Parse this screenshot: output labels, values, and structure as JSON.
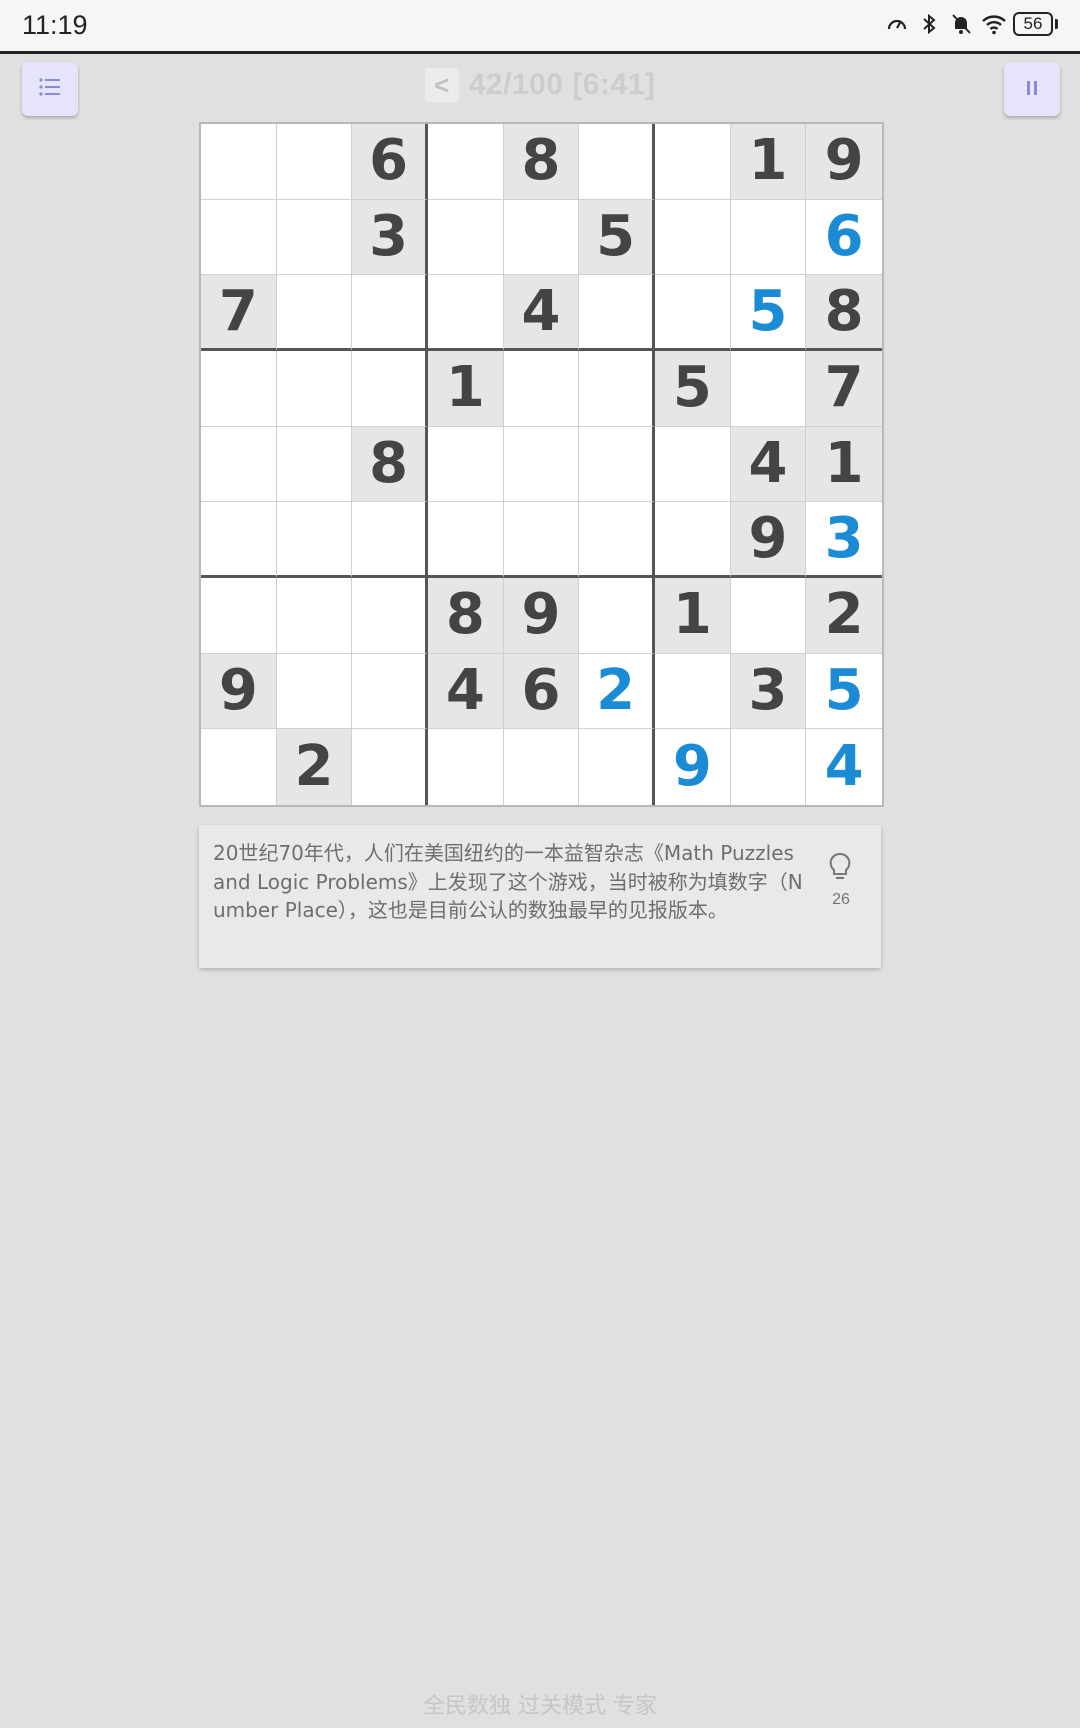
{
  "status_bar": {
    "time": "11:19",
    "battery": "56",
    "icons": [
      "speed-icon",
      "bluetooth-icon",
      "bell-off-icon",
      "wifi-icon"
    ]
  },
  "header": {
    "back_label": "<",
    "title": "42/100 [6:41]",
    "menu_icon": "menu-icon",
    "pause_icon": "pause-icon"
  },
  "board": {
    "rows": [
      [
        {
          "v": "",
          "t": "empty"
        },
        {
          "v": "",
          "t": "empty"
        },
        {
          "v": "6",
          "t": "given"
        },
        {
          "v": "",
          "t": "empty"
        },
        {
          "v": "8",
          "t": "given"
        },
        {
          "v": "",
          "t": "empty"
        },
        {
          "v": "",
          "t": "empty"
        },
        {
          "v": "1",
          "t": "given"
        },
        {
          "v": "9",
          "t": "given"
        }
      ],
      [
        {
          "v": "",
          "t": "empty"
        },
        {
          "v": "",
          "t": "empty"
        },
        {
          "v": "3",
          "t": "given"
        },
        {
          "v": "",
          "t": "empty"
        },
        {
          "v": "",
          "t": "empty"
        },
        {
          "v": "5",
          "t": "given"
        },
        {
          "v": "",
          "t": "empty"
        },
        {
          "v": "",
          "t": "empty"
        },
        {
          "v": "6",
          "t": "user"
        }
      ],
      [
        {
          "v": "7",
          "t": "given"
        },
        {
          "v": "",
          "t": "empty"
        },
        {
          "v": "",
          "t": "empty"
        },
        {
          "v": "",
          "t": "empty"
        },
        {
          "v": "4",
          "t": "given"
        },
        {
          "v": "",
          "t": "empty"
        },
        {
          "v": "",
          "t": "empty"
        },
        {
          "v": "5",
          "t": "user"
        },
        {
          "v": "8",
          "t": "given"
        }
      ],
      [
        {
          "v": "",
          "t": "empty"
        },
        {
          "v": "",
          "t": "empty"
        },
        {
          "v": "",
          "t": "empty"
        },
        {
          "v": "1",
          "t": "given"
        },
        {
          "v": "",
          "t": "empty"
        },
        {
          "v": "",
          "t": "empty"
        },
        {
          "v": "5",
          "t": "given"
        },
        {
          "v": "",
          "t": "empty"
        },
        {
          "v": "7",
          "t": "given"
        }
      ],
      [
        {
          "v": "",
          "t": "empty"
        },
        {
          "v": "",
          "t": "empty"
        },
        {
          "v": "8",
          "t": "given"
        },
        {
          "v": "",
          "t": "empty"
        },
        {
          "v": "",
          "t": "empty"
        },
        {
          "v": "",
          "t": "empty"
        },
        {
          "v": "",
          "t": "empty"
        },
        {
          "v": "4",
          "t": "given"
        },
        {
          "v": "1",
          "t": "given"
        }
      ],
      [
        {
          "v": "",
          "t": "empty"
        },
        {
          "v": "",
          "t": "empty"
        },
        {
          "v": "",
          "t": "empty"
        },
        {
          "v": "",
          "t": "empty"
        },
        {
          "v": "",
          "t": "empty"
        },
        {
          "v": "",
          "t": "empty"
        },
        {
          "v": "",
          "t": "empty"
        },
        {
          "v": "9",
          "t": "given"
        },
        {
          "v": "3",
          "t": "user"
        }
      ],
      [
        {
          "v": "",
          "t": "empty"
        },
        {
          "v": "",
          "t": "empty"
        },
        {
          "v": "",
          "t": "empty"
        },
        {
          "v": "8",
          "t": "given"
        },
        {
          "v": "9",
          "t": "given"
        },
        {
          "v": "",
          "t": "empty"
        },
        {
          "v": "1",
          "t": "given"
        },
        {
          "v": "",
          "t": "empty"
        },
        {
          "v": "2",
          "t": "given"
        }
      ],
      [
        {
          "v": "9",
          "t": "given"
        },
        {
          "v": "",
          "t": "empty"
        },
        {
          "v": "",
          "t": "empty"
        },
        {
          "v": "4",
          "t": "given"
        },
        {
          "v": "6",
          "t": "given"
        },
        {
          "v": "2",
          "t": "user"
        },
        {
          "v": "",
          "t": "empty"
        },
        {
          "v": "3",
          "t": "given"
        },
        {
          "v": "5",
          "t": "user"
        }
      ],
      [
        {
          "v": "",
          "t": "empty"
        },
        {
          "v": "2",
          "t": "given"
        },
        {
          "v": "",
          "t": "empty"
        },
        {
          "v": "",
          "t": "empty"
        },
        {
          "v": "",
          "t": "empty"
        },
        {
          "v": "",
          "t": "empty"
        },
        {
          "v": "9",
          "t": "user"
        },
        {
          "v": "",
          "t": "empty"
        },
        {
          "v": "4",
          "t": "user"
        }
      ]
    ]
  },
  "tip": {
    "text": "20世纪70年代，人们在美国纽约的一本益智杂志《Math Puzzles and Logic Problems》上发现了这个游戏，当时被称为填数字（Number Place），这也是目前公认的数独最早的见报版本。",
    "hint_icon": "lightbulb-icon",
    "hint_count": "26"
  },
  "footer": {
    "text": "全民数独 过关模式 专家"
  },
  "colors": {
    "background": "#e0e0e0",
    "given_cell": "#e6e6e6",
    "given_digit": "#444444",
    "user_digit": "#1c8bd6",
    "button_bg": "#e6e4fb"
  }
}
